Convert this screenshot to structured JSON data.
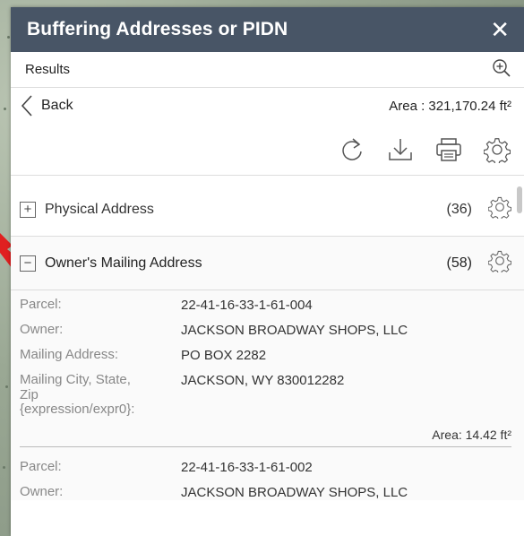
{
  "panel": {
    "title": "Buffering Addresses or PIDN"
  },
  "results_bar": {
    "label": "Results"
  },
  "nav": {
    "back_label": "Back",
    "area_total": "Area : 321,170.24 ft²"
  },
  "layers": [
    {
      "name": "Physical Address",
      "count": "(36)",
      "expanded": false
    },
    {
      "name": "Owner's Mailing Address",
      "count": "(58)",
      "expanded": true
    }
  ],
  "records": [
    {
      "parcel_label": "Parcel:",
      "parcel_value": "22-41-16-33-1-61-004",
      "owner_label": "Owner:",
      "owner_value": "JACKSON BROADWAY SHOPS, LLC",
      "mailing_label": "Mailing Address:",
      "mailing_value": "PO BOX 2282",
      "city_label_1": "Mailing City, State,",
      "city_label_2": "Zip",
      "city_label_3": "{expression/expr0}:",
      "city_value": "JACKSON, WY 830012282",
      "area": "Area: 14.42 ft²"
    },
    {
      "parcel_label": "Parcel:",
      "parcel_value": "22-41-16-33-1-61-002",
      "owner_label": "Owner:",
      "owner_value": "JACKSON BROADWAY SHOPS, LLC"
    }
  ],
  "icons": {
    "close": "close-icon",
    "zoom": "zoom-in-icon",
    "back": "chevron-left-icon",
    "refresh": "refresh-icon",
    "download": "download-icon",
    "print": "print-icon",
    "settings": "gear-icon"
  },
  "colors": {
    "titlebar": "#485566",
    "label_gray": "#888888",
    "annotation_arrow": "#e02020"
  }
}
